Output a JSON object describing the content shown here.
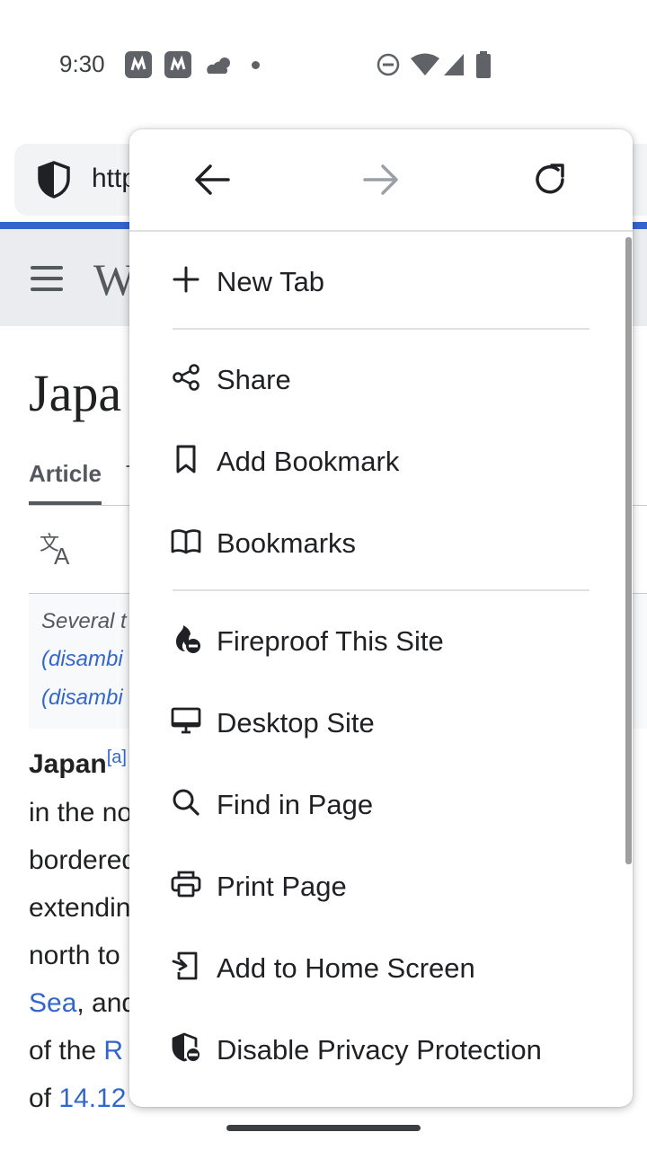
{
  "status_bar": {
    "time": "9:30"
  },
  "browser": {
    "url_partial": "http"
  },
  "page": {
    "logo_partial": "W",
    "title_partial": "Japa",
    "tab_article": "Article",
    "tab_second_partial": "T",
    "hatnote_line1": "Several t",
    "hatnote_line2": "(disambi",
    "hatnote_line3": "(disambi",
    "body_word_japan": "Japan",
    "body_sup": "[a]",
    "body_lines": [
      "in the no",
      "bordered",
      "extendin",
      "north to"
    ],
    "body_sea": "Sea",
    "body_sea_after": ", and",
    "body_of": "of the ",
    "body_of_link": "R",
    "body_of2": "of ",
    "body_of2_link": "14.12"
  },
  "menu": {
    "items": [
      {
        "label": "New Tab",
        "icon": "plus-icon"
      },
      {
        "label": "Share",
        "icon": "share-icon"
      },
      {
        "label": "Add Bookmark",
        "icon": "bookmark-icon"
      },
      {
        "label": "Bookmarks",
        "icon": "book-icon"
      },
      {
        "label": "Fireproof This Site",
        "icon": "fireproof-icon"
      },
      {
        "label": "Desktop Site",
        "icon": "desktop-icon"
      },
      {
        "label": "Find in Page",
        "icon": "search-icon"
      },
      {
        "label": "Print Page",
        "icon": "printer-icon"
      },
      {
        "label": "Add to Home Screen",
        "icon": "add-to-home-icon"
      },
      {
        "label": "Disable Privacy Protection",
        "icon": "shield-off-icon"
      }
    ]
  },
  "colors": {
    "link": "#3366cc",
    "progress": "#3366cc",
    "menu_bg": "#ffffff"
  }
}
